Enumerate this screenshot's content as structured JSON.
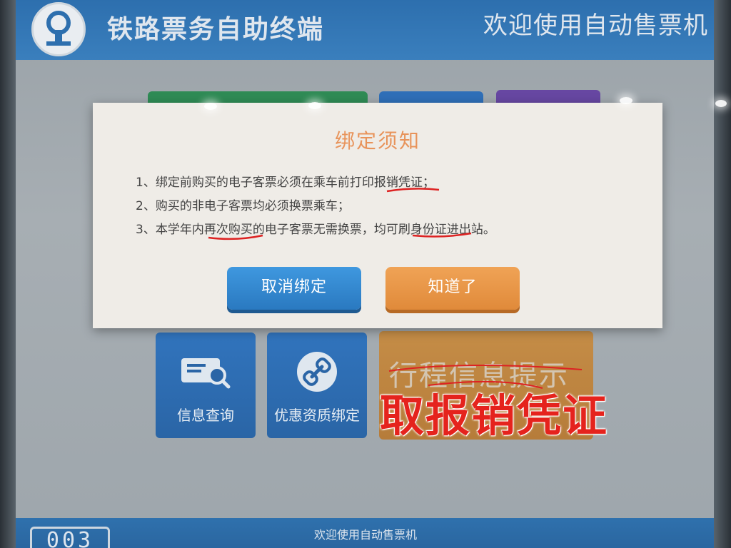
{
  "header": {
    "title": "铁路票务自助终端",
    "welcome": "欢迎使用自动售票机"
  },
  "modal": {
    "title": "绑定须知",
    "rules": [
      "1、绑定前购买的电子客票必须在乘车前打印报销凭证；",
      "2、购买的非电子客票均必须换票乘车；",
      "3、本学年内再次购买的电子客票无需换票，均可刷身份证进出站。"
    ],
    "cancel_button": "取消绑定",
    "ok_button": "知道了"
  },
  "menu": {
    "info_query": "信息查询",
    "discount_binding": "优惠资质绑定",
    "trip_info": "行程信息提示"
  },
  "footer": {
    "text": "欢迎使用自动售票机",
    "counter": "003"
  },
  "annotation": {
    "text": "取报销凭证",
    "color": "#e5231d"
  },
  "colors": {
    "header_blue": "#2d6fae",
    "modal_title_orange": "#e8935a",
    "cancel_blue": "#2a79c0",
    "ok_orange": "#e08a3a"
  }
}
